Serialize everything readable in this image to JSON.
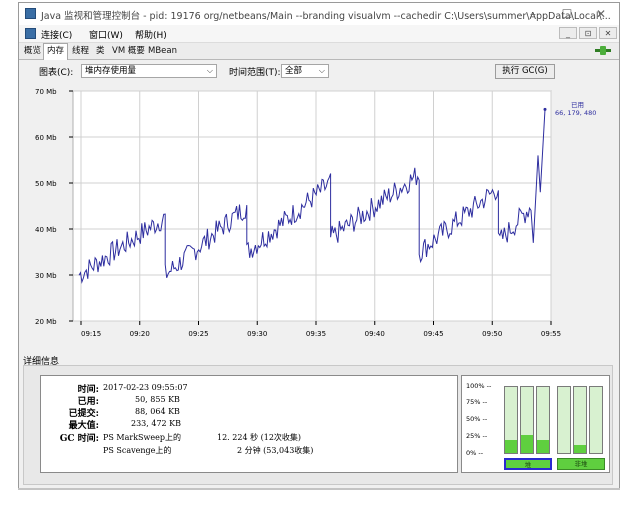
{
  "window": {
    "title": "Java 监视和管理控制台 - pid: 19176 org/netbeans/Main --branding visualvm --cachedir C:\\Users\\summer\\AppData\\Local\\...",
    "minimize": "–",
    "maximize": "☐",
    "close": "✕"
  },
  "menu": {
    "items": [
      "连接(C)",
      "窗口(W)",
      "帮助(H)"
    ],
    "mdi_buttons": [
      "_",
      "⊡",
      "✕"
    ]
  },
  "tabs": {
    "items": [
      "概览",
      "内存",
      "线程",
      "类",
      "VM 概要",
      "MBean"
    ],
    "active_index": 1
  },
  "controls": {
    "chart_label": "图表(C):",
    "chart_value": "堆内存使用量",
    "range_label": "时间范围(T):",
    "range_value": "全部",
    "gc_button": "执行 GC(G)"
  },
  "chart_data": {
    "type": "line",
    "y_ticks": [
      "70 Mb",
      "60 Mb",
      "50 Mb",
      "40 Mb",
      "30 Mb",
      "20 Mb"
    ],
    "x_ticks": [
      "09:15",
      "09:20",
      "09:25",
      "09:30",
      "09:35",
      "09:40",
      "09:45",
      "09:50",
      "09:55"
    ],
    "ylim": [
      20,
      70
    ],
    "xlim": [
      0,
      1
    ],
    "grid": true,
    "series_label": "已用",
    "series_value": "66, 179, 480",
    "series_color": "#2d2d9f",
    "segments": [
      {
        "x0": 0.0,
        "x1": 0.185,
        "y0": 30,
        "y1": 42.5
      },
      {
        "x0": 0.185,
        "x1": 0.36,
        "y0": 30,
        "y1": 45
      },
      {
        "x0": 0.36,
        "x1": 0.54,
        "y0": 35,
        "y1": 50
      },
      {
        "x0": 0.54,
        "x1": 0.73,
        "y0": 38,
        "y1": 52
      },
      {
        "x0": 0.73,
        "x1": 0.9,
        "y0": 35,
        "y1": 49
      },
      {
        "x0": 0.9,
        "x1": 0.97,
        "y0": 37,
        "y1": 45
      }
    ],
    "spike": [
      {
        "x": 0.975,
        "y": 37
      },
      {
        "x": 0.985,
        "y": 56
      },
      {
        "x": 0.99,
        "y": 48
      },
      {
        "x": 1.0,
        "y": 66
      }
    ]
  },
  "details": {
    "title": "详细信息",
    "rows": [
      {
        "label": "时间:",
        "value": "2017-02-23 09:55:07"
      },
      {
        "label": "已用:",
        "value": "50, 855 KB"
      },
      {
        "label": "已提交:",
        "value": "88, 064 KB"
      },
      {
        "label": "最大值:",
        "value": "233, 472 KB"
      }
    ],
    "gc_label": "GC 时间:",
    "gc_rows": [
      {
        "name": "PS MarkSweep上的",
        "time": "12. 224 秒 (12次收集)"
      },
      {
        "name": "PS Scavenge上的",
        "time": "2 分钟 (53,043收集)"
      }
    ]
  },
  "gauge": {
    "ticks": [
      "100% --",
      "75% --",
      "50% --",
      "25% --",
      "0% --"
    ],
    "heap_levels": [
      0.2,
      0.28,
      0.2
    ],
    "nonheap_levels": [
      0.0,
      0.12,
      0.0
    ],
    "heap_label": "堆",
    "nonheap_label": "非堆"
  }
}
